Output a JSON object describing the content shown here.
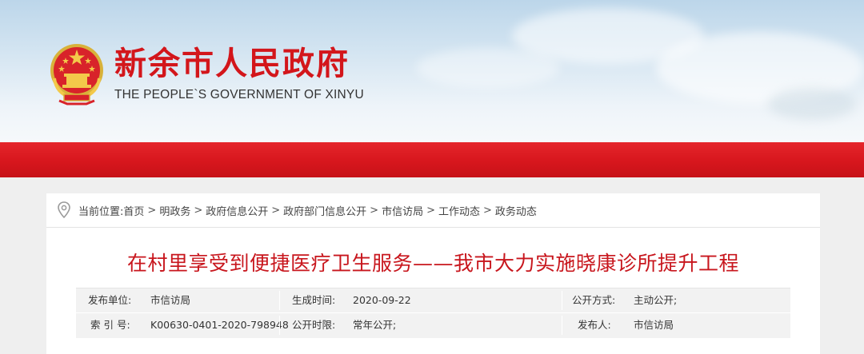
{
  "header": {
    "title": "新余市人民政府",
    "subtitle": "THE PEOPLE`S GOVERNMENT OF XINYU",
    "brand_color": "#d3161b",
    "emblem_icon": "national-emblem-icon"
  },
  "breadcrumb": {
    "icon": "location-pin-icon",
    "prefix": "当前位置:",
    "items": [
      "首页",
      "明政务",
      "政府信息公开",
      "政府部门信息公开",
      "市信访局",
      "工作动态",
      "政务动态"
    ],
    "separator": ">"
  },
  "article": {
    "title": "在村里享受到便捷医疗卫生服务——我市大力实施晓康诊所提升工程",
    "title_color": "#c8161d"
  },
  "meta": {
    "publisher_unit_label": "发布单位:",
    "publisher_unit_value": "市信访局",
    "created_label": "生成时间:",
    "created_value": "2020-09-22",
    "disclosure_mode_label": "公开方式:",
    "disclosure_mode_value": "主动公开;",
    "index_label": "索 引 号:",
    "index_value": "K00630-0401-2020-798948",
    "disclosure_period_label": "公开时限:",
    "disclosure_period_value": "常年公开;",
    "publisher_label": "发布人:",
    "publisher_value": "市信访局"
  }
}
